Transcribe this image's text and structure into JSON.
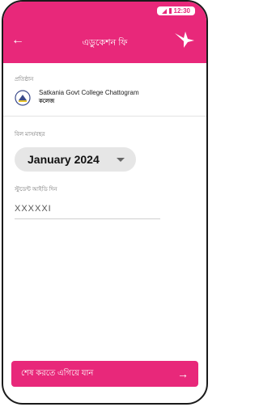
{
  "status_bar": {
    "time": "12:30"
  },
  "header": {
    "title": "এডুকেশন ফি",
    "back_icon": "back-arrow-icon",
    "logo_icon": "bird-logo-icon"
  },
  "institution": {
    "label": "প্রতিষ্ঠান",
    "name": "Satkania Govt College Chattogram",
    "type": "কলেজ"
  },
  "month": {
    "label": "বিল মাস/বছর",
    "value": "January 2024"
  },
  "student_id": {
    "label": "স্টুডেন্ট আইডি দিন",
    "value": "XXXXXI"
  },
  "footer": {
    "label": "শেষ করতে এগিয়ে যান",
    "arrow": "→"
  },
  "colors": {
    "accent": "#e8287a"
  }
}
